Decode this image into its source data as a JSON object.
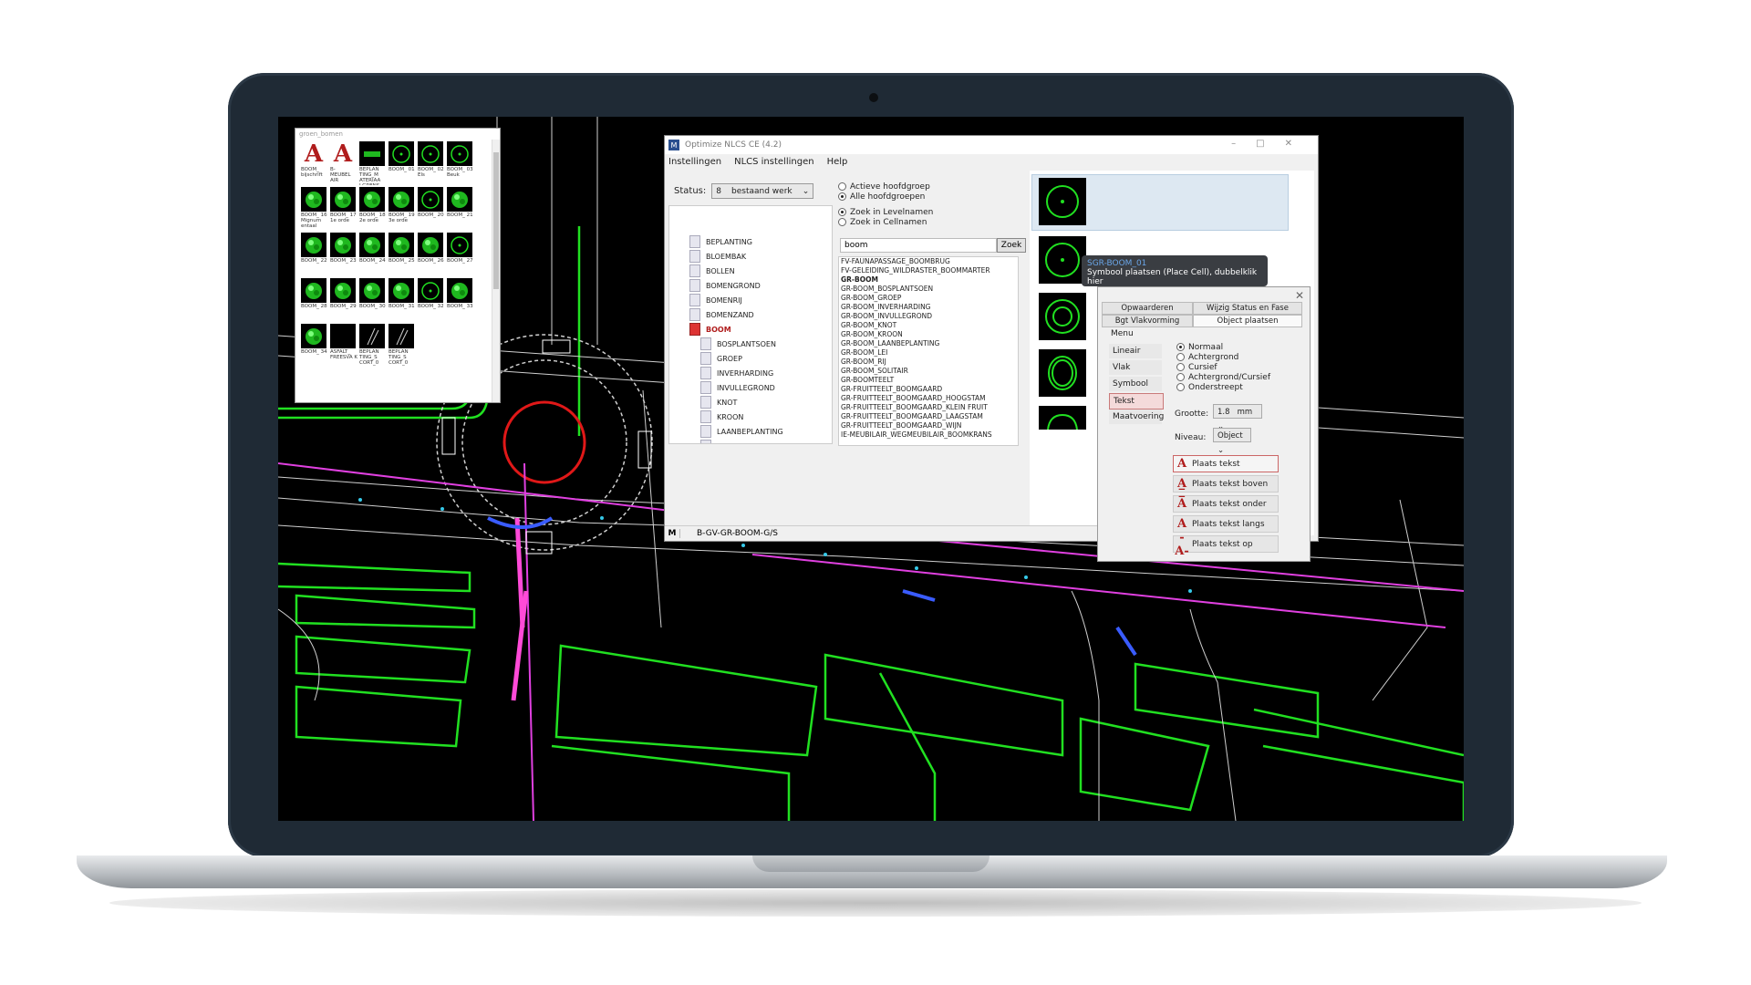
{
  "celllib": {
    "title": "groen_bomen",
    "cells": [
      {
        "label": "BOOM_ bijschrift",
        "thumb": "A"
      },
      {
        "label": "B- MEUBEL AIR",
        "thumb": "A"
      },
      {
        "label": "BEPLAN TING_M ATERIAA LGRENS",
        "thumb": "dash"
      },
      {
        "label": "BOOM_ 01",
        "thumb": "circle"
      },
      {
        "label": "BOOM_ 02 Els",
        "thumb": "circle"
      },
      {
        "label": "BOOM_ 03 Beuk",
        "thumb": "circle"
      },
      {
        "label": "BOOM_ 16 Mignum entaal",
        "thumb": "tree"
      },
      {
        "label": "BOOM_ 17 1e orde",
        "thumb": "tree"
      },
      {
        "label": "BOOM_ 18 2e orde",
        "thumb": "tree"
      },
      {
        "label": "BOOM_ 19 3e orde",
        "thumb": "tree"
      },
      {
        "label": "BOOM_ 20",
        "thumb": "circle"
      },
      {
        "label": "BOOM_ 21",
        "thumb": "tree"
      },
      {
        "label": "BOOM_ 22",
        "thumb": "tree"
      },
      {
        "label": "BOOM_ 23",
        "thumb": "tree"
      },
      {
        "label": "BOOM_ 24",
        "thumb": "tree"
      },
      {
        "label": "BOOM_ 25",
        "thumb": "tree"
      },
      {
        "label": "BOOM_ 26",
        "thumb": "tree"
      },
      {
        "label": "BOOM_ 27",
        "thumb": "circle"
      },
      {
        "label": "BOOM_ 28",
        "thumb": "tree"
      },
      {
        "label": "BOOM_ 29",
        "thumb": "tree"
      },
      {
        "label": "BOOM_ 30",
        "thumb": "tree"
      },
      {
        "label": "BOOM_ 31",
        "thumb": "tree"
      },
      {
        "label": "BOOM_ 32",
        "thumb": "circle"
      },
      {
        "label": "BOOM_ 33",
        "thumb": "tree"
      },
      {
        "label": "BOOM_ 34",
        "thumb": "tree"
      },
      {
        "label": "ASFALT_ FREESVA K",
        "thumb": "empty"
      },
      {
        "label": "BEPLAN TING_S CORT_0",
        "thumb": "line"
      },
      {
        "label": "BEPLAN TING_S CORT_0",
        "thumb": "line"
      }
    ]
  },
  "nlcs": {
    "title": "Optimize NLCS CE (4.2)",
    "menu": [
      "Instellingen",
      "NLCS instellingen",
      "Help"
    ],
    "status_label": "Status:",
    "status_code": "8",
    "status_value": "bestaand werk",
    "tree": [
      {
        "label": "BEPLANTING",
        "level": 1
      },
      {
        "label": "BLOEMBAK",
        "level": 1
      },
      {
        "label": "BOLLEN",
        "level": 1
      },
      {
        "label": "BOMENGROND",
        "level": 1
      },
      {
        "label": "BOMENRIJ",
        "level": 1
      },
      {
        "label": "BOMENZAND",
        "level": 1
      },
      {
        "label": "BOOM",
        "level": 1,
        "selected": true
      },
      {
        "label": "BOSPLANTSOEN",
        "level": 2
      },
      {
        "label": "GROEP",
        "level": 2
      },
      {
        "label": "INVERHARDING",
        "level": 2
      },
      {
        "label": "INVULLEGROND",
        "level": 2
      },
      {
        "label": "KNOT",
        "level": 2
      },
      {
        "label": "KROON",
        "level": 2
      },
      {
        "label": "LAANBEPLANTING",
        "level": 2
      },
      {
        "label": "LEI",
        "level": 2
      }
    ],
    "options": {
      "group1": [
        "Actieve hoofdgroep",
        "Alle hoofdgroepen"
      ],
      "group1_selected": 1,
      "group2": [
        "Zoek in Levelnamen",
        "Zoek in Cellnamen"
      ],
      "group2_selected": 0
    },
    "search_value": "boom",
    "search_button": "Zoek",
    "levels": [
      {
        "name": "FV-FAUNAPASSAGE_BOOMBRUG"
      },
      {
        "name": "FV-GELEIDING_WILDRASTER_BOOMMARTER"
      },
      {
        "name": "GR-BOOM",
        "bold": true
      },
      {
        "name": "GR-BOOM_BOSPLANTSOEN"
      },
      {
        "name": "GR-BOOM_GROEP"
      },
      {
        "name": "GR-BOOM_INVERHARDING"
      },
      {
        "name": "GR-BOOM_INVULLEGROND"
      },
      {
        "name": "GR-BOOM_KNOT"
      },
      {
        "name": "GR-BOOM_KROON"
      },
      {
        "name": "GR-BOOM_LAANBEPLANTING"
      },
      {
        "name": "GR-BOOM_LEI"
      },
      {
        "name": "GR-BOOM_RIJ"
      },
      {
        "name": "GR-BOOM_SOLITAIR"
      },
      {
        "name": "GR-BOOMTEELT"
      },
      {
        "name": "GR-FRUITTEELT_BOOMGAARD"
      },
      {
        "name": "GR-FRUITTEELT_BOOMGAARD_HOOGSTAM"
      },
      {
        "name": "GR-FRUITTEELT_BOOMGAARD_KLEIN FRUIT"
      },
      {
        "name": "GR-FRUITTEELT_BOOMGAARD_LAAGSTAM"
      },
      {
        "name": "GR-FRUITTEELT_BOOMGAARD_WIJN"
      },
      {
        "name": "IE-MEUBILAIR_WEGMEUBILAIR_BOOMKRANS"
      }
    ],
    "footer_m": "M",
    "footer_path": "B-GV-GR-BOOM-G/S"
  },
  "tooltip": {
    "cell_name": "SGR-BOOM_01",
    "hint": "Symbool plaatsen (Place Cell), dubbelklik hier"
  },
  "panel": {
    "tabs": [
      "Opwaarderen",
      "Wijzig Status en Fase",
      "Bgt Vlakvorming",
      "Object plaatsen"
    ],
    "menu_label": "Menu",
    "menu_items": [
      "Lineair",
      "Vlak",
      "Symbool",
      "Tekst",
      "Maatvoering"
    ],
    "menu_active": "Tekst",
    "styles": [
      "Normaal",
      "Achtergrond",
      "Cursief",
      "Achtergrond/Cursief",
      "Onderstreept"
    ],
    "style_selected": 0,
    "grootte_label": "Grootte:",
    "grootte_value": "1.8",
    "grootte_unit": "mm",
    "niveau_label": "Niveau:",
    "niveau_value": "Object",
    "actions": [
      "Plaats tekst",
      "Plaats tekst boven",
      "Plaats tekst onder",
      "Plaats tekst langs",
      "Plaats tekst op"
    ]
  },
  "colors": {
    "green": "#21e021",
    "magenta": "#e040e0",
    "red": "#e01818",
    "blue": "#3a5cff",
    "accent_red": "#b01c1c"
  }
}
